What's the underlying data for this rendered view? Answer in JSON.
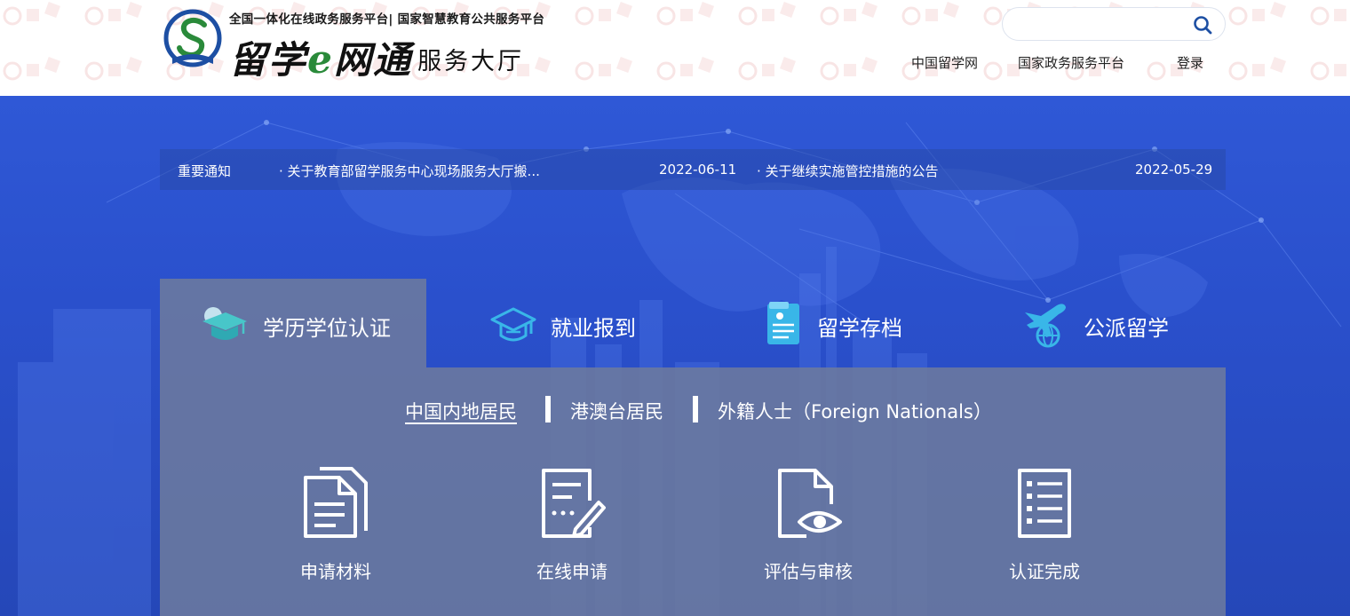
{
  "header": {
    "logo": {
      "subtitle": "全国一体化在线政务服务平台| 国家智慧教育公共服务平台",
      "brand_part1": "留学",
      "brand_e": "e",
      "brand_part2": "网通",
      "hall": "服务大厅"
    },
    "search": {
      "value": "",
      "placeholder": ""
    },
    "nav": [
      {
        "label": "中国留学网"
      },
      {
        "label": "国家政务服务平台"
      },
      {
        "label": "登录"
      }
    ]
  },
  "notice": {
    "label": "重要通知",
    "items": [
      {
        "title": "关于教育部留学服务中心现场服务大厅搬...",
        "date": "2022-06-11"
      },
      {
        "title": "关于继续实施管控措施的公告",
        "date": "2022-05-29"
      }
    ]
  },
  "tabs": [
    {
      "label": "学历学位认证",
      "icon": "graduation-cap-icon",
      "active": true
    },
    {
      "label": "就业报到",
      "icon": "mortarboard-outline-icon",
      "active": false
    },
    {
      "label": "留学存档",
      "icon": "archive-document-icon",
      "active": false
    },
    {
      "label": "公派留学",
      "icon": "plane-globe-icon",
      "active": false
    }
  ],
  "subtabs": [
    {
      "label": "中国内地居民",
      "active": true
    },
    {
      "label": "港澳台居民",
      "active": false
    },
    {
      "label": "外籍人士（Foreign Nationals）",
      "active": false
    }
  ],
  "steps": [
    {
      "label": "申请材料",
      "icon": "documents-icon"
    },
    {
      "label": "在线申请",
      "icon": "edit-form-icon"
    },
    {
      "label": "评估与审核",
      "icon": "file-review-eye-icon"
    },
    {
      "label": "认证完成",
      "icon": "checklist-icon"
    }
  ],
  "colors": {
    "hero_blue": "#2f58d6",
    "panel_gray": "#6c7a9e",
    "logo_blue": "#1d4fa3",
    "logo_green": "#2a8a3a",
    "icon_cyan": "#39b6e8",
    "search_icon": "#1d4fa3"
  }
}
